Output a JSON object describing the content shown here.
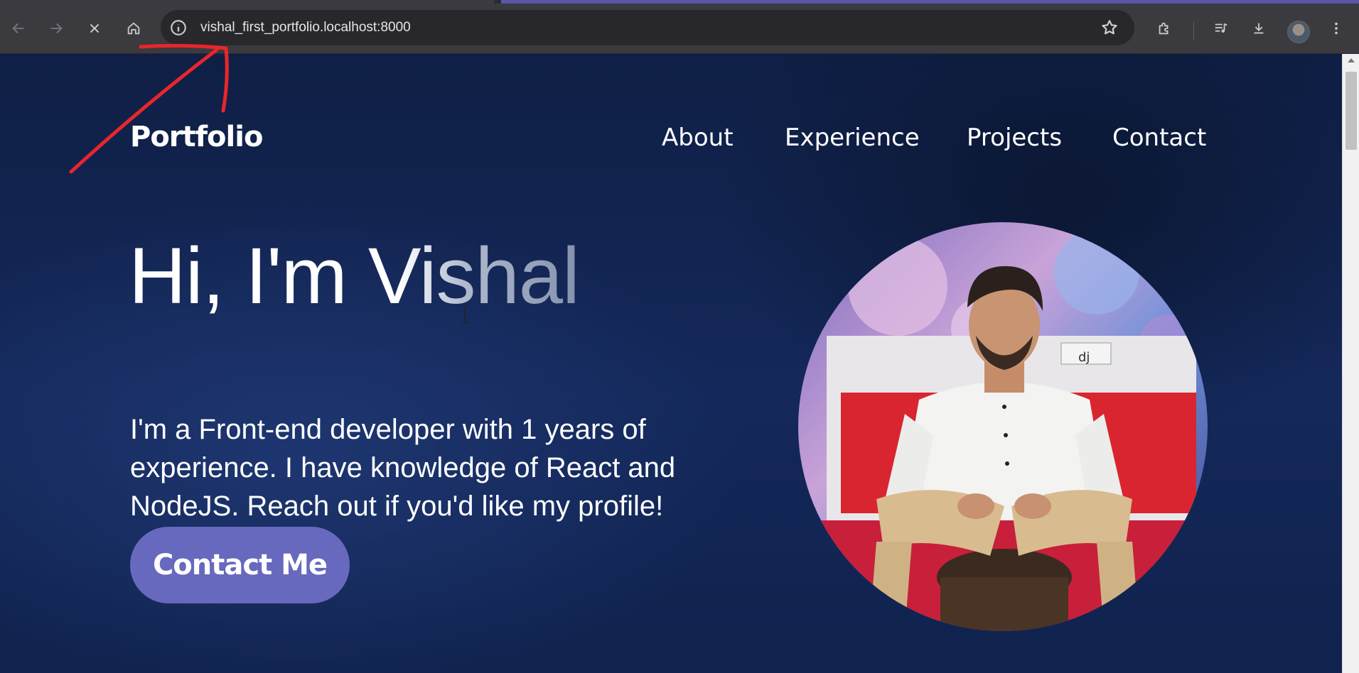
{
  "browser": {
    "url": "vishal_first_portfolio.localhost:8000",
    "icons": {
      "back": "arrow-left-icon",
      "forward": "arrow-right-icon",
      "stop": "close-icon",
      "home": "home-icon",
      "site_info": "info-icon",
      "bookmark": "star-icon",
      "extensions": "puzzle-icon",
      "media": "media-controls-icon",
      "downloads": "download-icon",
      "profile": "avatar-icon",
      "menu": "kebab-menu-icon"
    }
  },
  "site": {
    "logo": "Portfolio",
    "nav": [
      "About",
      "Experience",
      "Projects",
      "Contact"
    ],
    "hero": {
      "title": "Hi, I'm Vishal",
      "description": "I'm a Front-end developer with 1 years of experience. I have knowledge of React and NodeJS. Reach out if you'd like my profile!",
      "cta": "Contact Me"
    }
  },
  "colors": {
    "page_background": "#11244f",
    "cta_background": "#6669bd",
    "annotation_stroke": "#e8262b"
  }
}
